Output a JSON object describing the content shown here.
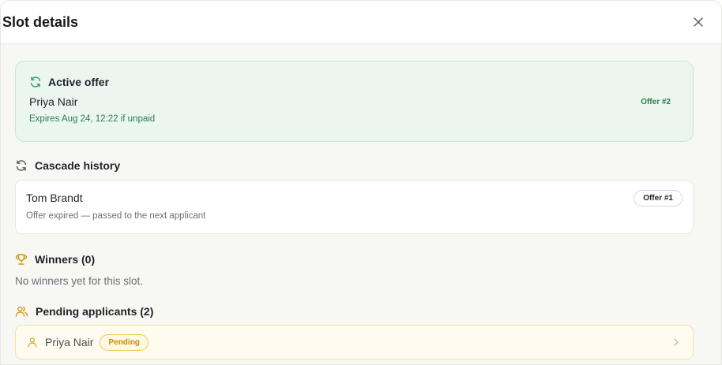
{
  "header": {
    "title": "Slot details"
  },
  "active_offer": {
    "title": "Active offer",
    "name": "Priya Nair",
    "expires": "Expires Aug 24, 12:22 if unpaid",
    "offer_tag": "Offer #2"
  },
  "cascade": {
    "title": "Cascade history",
    "items": [
      {
        "name": "Tom Brandt",
        "desc": "Offer expired — passed to the next applicant",
        "offer_tag": "Offer #1"
      }
    ]
  },
  "winners": {
    "title": "Winners (0)",
    "empty": "No winners yet for this slot."
  },
  "pending": {
    "title": "Pending applicants (2)",
    "items": [
      {
        "name": "Priya Nair",
        "status": "Pending"
      }
    ]
  },
  "colors": {
    "active_bg": "#eaf6ef",
    "active_accent": "#2f7d4f",
    "pending_bg": "#fffcef",
    "pending_accent": "#c58a0d",
    "trophy": "#d9930d"
  },
  "icons": {
    "close": "close-icon",
    "active": "refresh-icon",
    "cascade": "refresh-icon",
    "winners": "trophy-icon",
    "pending": "users-icon",
    "applicant": "user-icon",
    "row_action": "chevron-right-icon"
  }
}
